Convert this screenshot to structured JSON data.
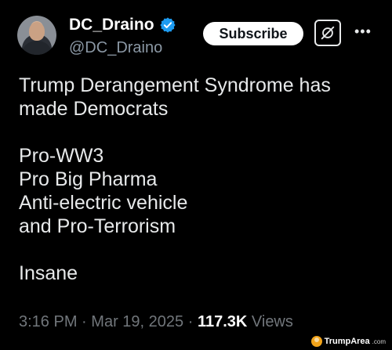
{
  "author": {
    "display_name": "DC_Draino",
    "handle": "@DC_Draino",
    "verified_color": "#1d9bf0"
  },
  "actions": {
    "subscribe_label": "Subscribe",
    "grok_icon": "grok-icon",
    "more_icon": "more-icon"
  },
  "tweet": {
    "lines": [
      "Trump Derangement Syndrome has",
      "made Democrats",
      "",
      "Pro-WW3",
      "Pro Big Pharma",
      "Anti-electric vehicle",
      "and Pro-Terrorism",
      "",
      "Insane"
    ]
  },
  "meta": {
    "time": "3:16 PM",
    "separator": "·",
    "date": "Mar 19, 2025",
    "views_count": "117.3K",
    "views_label": "Views"
  },
  "watermark": {
    "text": "TrumpArea",
    "suffix": ".com"
  }
}
